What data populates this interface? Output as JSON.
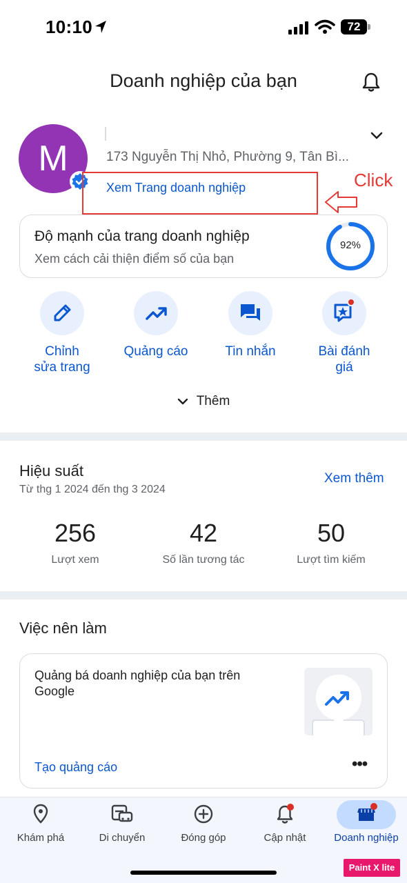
{
  "status_bar": {
    "time": "10:10",
    "battery": "72"
  },
  "header": {
    "title": "Doanh nghiệp của bạn"
  },
  "profile": {
    "avatar_letter": "M",
    "address": "173 Nguyễn Thị Nhỏ, Phường 9, Tân Bì...",
    "view_page_link": "Xem Trang doanh nghiệp"
  },
  "annotation": {
    "click_label": "Click"
  },
  "strength_card": {
    "title": "Độ mạnh của trang doanh nghiệp",
    "subtitle": "Xem cách cải thiện điểm số của bạn",
    "percent_label": "92%",
    "percent_value": 92
  },
  "actions": [
    {
      "label_line1": "Chỉnh",
      "label_line2": "sửa trang",
      "icon": "pencil-icon"
    },
    {
      "label_line1": "Quảng cáo",
      "label_line2": "",
      "icon": "trending-up-icon"
    },
    {
      "label_line1": "Tin nhắn",
      "label_line2": "",
      "icon": "chat-icon"
    },
    {
      "label_line1": "Bài đánh",
      "label_line2": "giá",
      "icon": "review-star-icon"
    }
  ],
  "more_label": "Thêm",
  "performance": {
    "title": "Hiệu suất",
    "range": "Từ thg 1 2024 đến thg 3 2024",
    "see_more": "Xem thêm",
    "stats": [
      {
        "value": "256",
        "label": "Lượt xem"
      },
      {
        "value": "42",
        "label": "Số lần tương tác"
      },
      {
        "value": "50",
        "label": "Lượt tìm kiếm"
      }
    ]
  },
  "todo": {
    "title": "Việc nên làm",
    "card_text": "Quảng bá doanh nghiệp của bạn trên Google",
    "card_link": "Tạo quảng cáo",
    "menu_dots": "•••"
  },
  "bottom_nav": [
    {
      "label": "Khám phá",
      "icon": "location-pin-icon"
    },
    {
      "label": "Di chuyển",
      "icon": "commute-icon"
    },
    {
      "label": "Đóng góp",
      "icon": "add-circle-icon"
    },
    {
      "label": "Cập nhật",
      "icon": "bell-icon"
    },
    {
      "label": "Doanh nghiệp",
      "icon": "storefront-icon"
    }
  ],
  "watermark": "Paint X lite",
  "colors": {
    "accent": "#0b57d0",
    "avatar": "#9334b5",
    "annotation_red": "#e53935",
    "ring": "#1a73e8"
  }
}
